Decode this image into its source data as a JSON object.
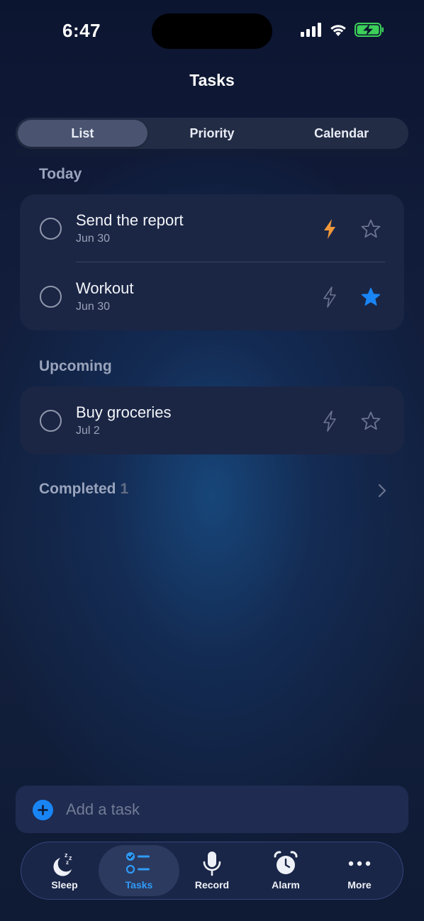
{
  "status_bar": {
    "time": "6:47"
  },
  "header": {
    "title": "Tasks"
  },
  "segments": [
    {
      "label": "List",
      "active": true
    },
    {
      "label": "Priority",
      "active": false
    },
    {
      "label": "Calendar",
      "active": false
    }
  ],
  "sections": {
    "today": {
      "label": "Today",
      "tasks": [
        {
          "title": "Send the report",
          "date": "Jun 30",
          "priority": true,
          "starred": false
        },
        {
          "title": "Workout",
          "date": "Jun 30",
          "priority": false,
          "starred": true
        }
      ]
    },
    "upcoming": {
      "label": "Upcoming",
      "tasks": [
        {
          "title": "Buy groceries",
          "date": "Jul 2",
          "priority": false,
          "starred": false
        }
      ]
    },
    "completed": {
      "label": "Completed",
      "count": "1"
    }
  },
  "add_task": {
    "placeholder": "Add a task"
  },
  "tabbar": {
    "items": [
      {
        "label": "Sleep",
        "icon": "moon-zzz-icon"
      },
      {
        "label": "Tasks",
        "icon": "checklist-icon",
        "active": true
      },
      {
        "label": "Record",
        "icon": "microphone-icon"
      },
      {
        "label": "Alarm",
        "icon": "alarm-clock-icon"
      },
      {
        "label": "More",
        "icon": "ellipsis-icon"
      }
    ]
  },
  "colors": {
    "accent": "#1985f5",
    "priority_active": "#f0973a",
    "star_active": "#1985f5",
    "tab_active": "#2f9bf6"
  }
}
